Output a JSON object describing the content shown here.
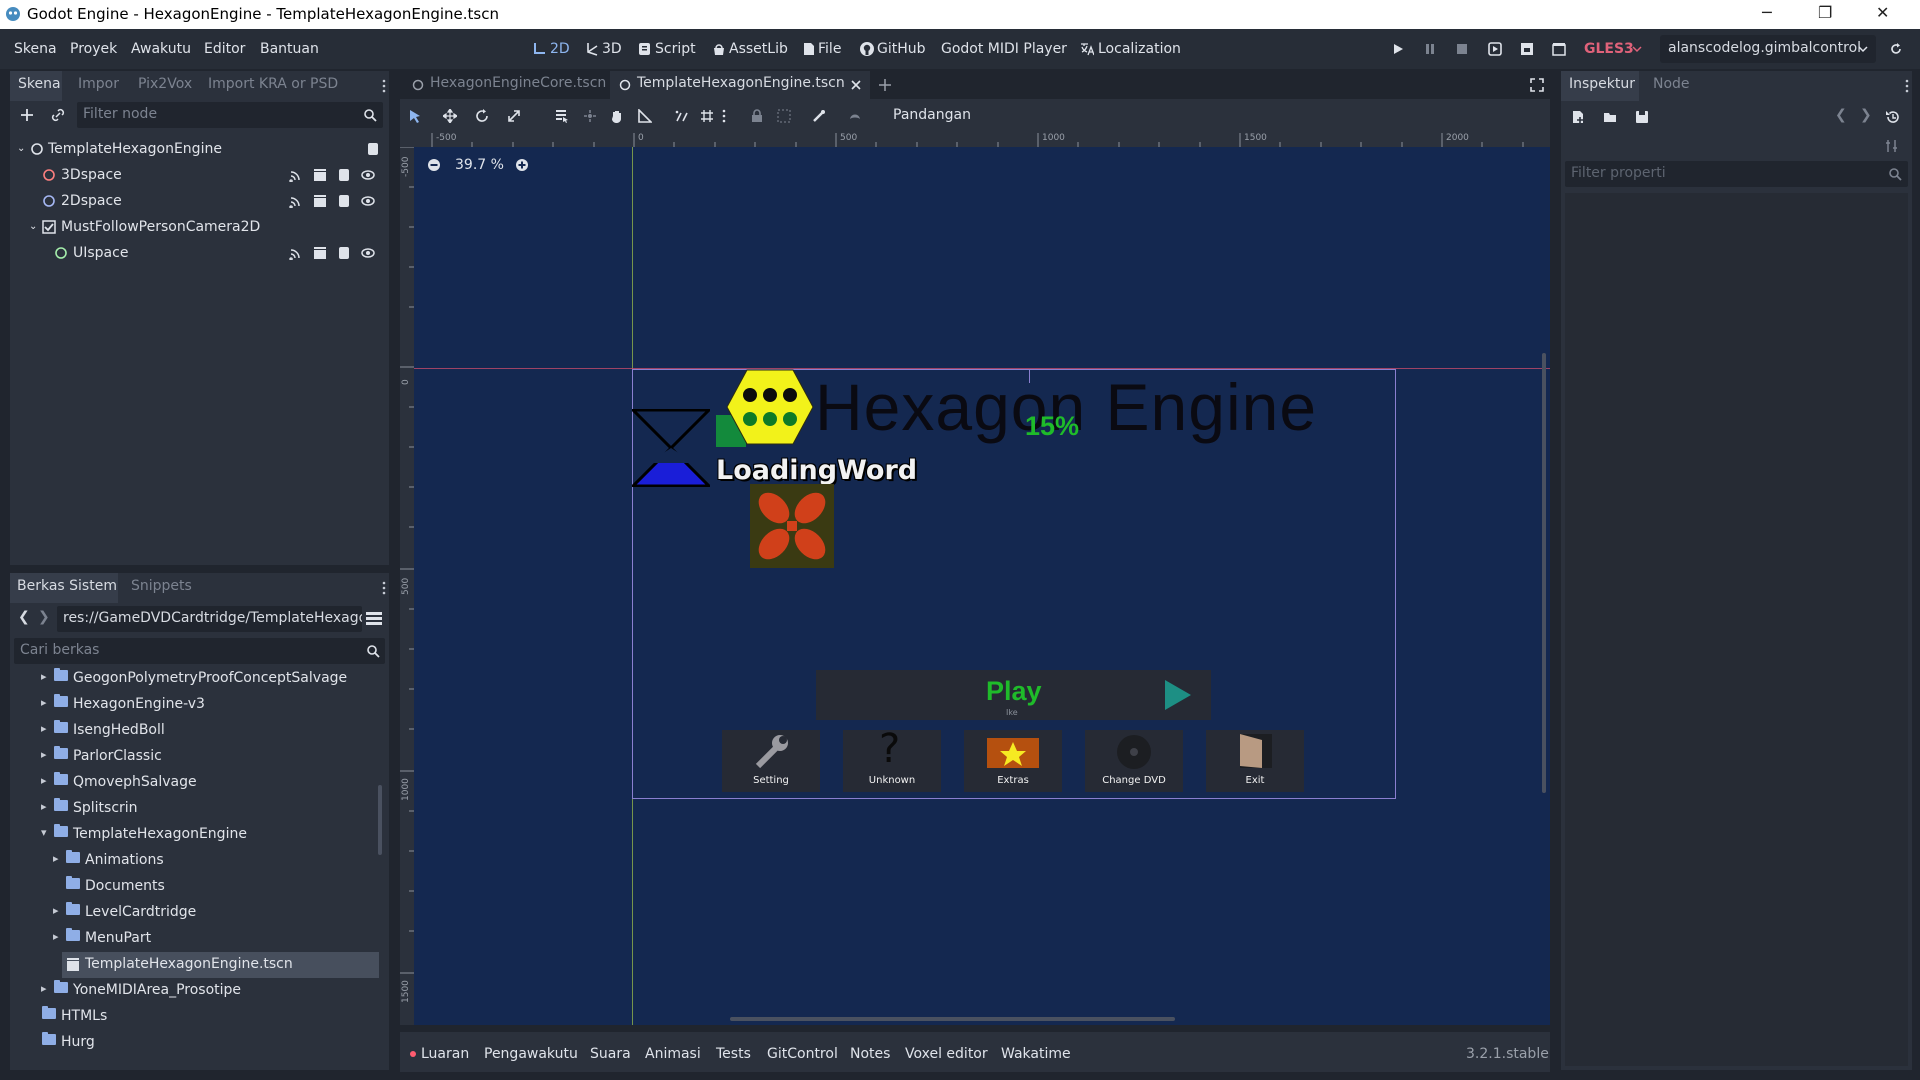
{
  "window": {
    "title": "Godot Engine - HexagonEngine - TemplateHexagonEngine.tscn",
    "minimize_glyph": "─",
    "restore_glyph": "❐",
    "close_glyph": "✕"
  },
  "menus": [
    "Skena",
    "Proyek",
    "Awakutu",
    "Editor",
    "Bantuan"
  ],
  "workspaces": [
    "2D",
    "3D",
    "Script",
    "AssetLib",
    "File",
    "GitHub",
    "Godot MIDI Player",
    "Localization"
  ],
  "run_bar": {
    "renderer": "GLES3",
    "remote": "alanscodelog.gimbalcontrol"
  },
  "scene_dock": {
    "tabs": [
      "Skena",
      "Impor",
      "Pix2Vox",
      "Import KRA or PSD"
    ],
    "filter_placeholder": "Filter node",
    "nodes": [
      {
        "name": "TemplateHexagonEngine",
        "type": "root"
      },
      {
        "name": "3Dspace",
        "type": "spatial"
      },
      {
        "name": "2Dspace",
        "type": "spatial"
      },
      {
        "name": "MustFollowPersonCamera2D",
        "type": "camera2d"
      },
      {
        "name": "UIspace",
        "type": "control"
      }
    ]
  },
  "filesystem_dock": {
    "tabs": [
      "Berkas Sistem",
      "Snippets"
    ],
    "path": "res://GameDVDCardtridge/TemplateHexago",
    "search_placeholder": "Cari berkas",
    "items": [
      {
        "name": "GeogonPolymetryProofConceptSalvage",
        "level": 2
      },
      {
        "name": "HexagonEngine-v3",
        "level": 2
      },
      {
        "name": "IsengHedBoll",
        "level": 2
      },
      {
        "name": "ParlorClassic",
        "level": 2
      },
      {
        "name": "QmovephSalvage",
        "level": 2
      },
      {
        "name": "Splitscrin",
        "level": 2
      },
      {
        "name": "TemplateHexagonEngine",
        "level": 2
      },
      {
        "name": "Animations",
        "level": 3
      },
      {
        "name": "Documents",
        "level": 3
      },
      {
        "name": "LevelCardtridge",
        "level": 3
      },
      {
        "name": "MenuPart",
        "level": 3
      },
      {
        "name": "TemplateHexagonEngine.tscn",
        "level": 3
      },
      {
        "name": "YoneMIDIArea_Prosotipe",
        "level": 2
      },
      {
        "name": "HTMLs",
        "level": 1
      },
      {
        "name": "Hurg",
        "level": 1
      }
    ]
  },
  "editor_tabs": [
    "HexagonEngineCore.tscn",
    "TemplateHexagonEngine.tscn"
  ],
  "toolbar": {
    "view_menu": "Pandangan"
  },
  "viewport": {
    "zoom": "39.7 %",
    "ruler_h": [
      "-500",
      "0",
      "500",
      "1000",
      "1500",
      "2000"
    ],
    "ruler_v": [
      "-500",
      "0",
      "500",
      "1000",
      "1500"
    ],
    "scene": {
      "title": "Hexagon Engine",
      "percent": "15%",
      "loading_word": "LoadingWord",
      "play_label": "Play",
      "play_sub": "Ike",
      "menu_buttons": [
        "Setting",
        "Unknown",
        "Extras",
        "Change DVD",
        "Exit"
      ]
    }
  },
  "inspector": {
    "tabs": [
      "Inspektur",
      "Node"
    ],
    "filter_placeholder": "Filter properti"
  },
  "bottom_panel": {
    "tabs": [
      "Luaran",
      "Pengawakutu",
      "Suara",
      "Animasi",
      "Tests",
      "GitControl",
      "Notes",
      "Voxel editor",
      "Wakatime"
    ],
    "version": "3.2.1.stable"
  },
  "colors": {
    "accent": "#8eb6f0",
    "viewport_bg": "#142850",
    "error_dot": "#ff5c70",
    "gles_red": "#e0627a",
    "play_green": "#1fbb2a",
    "play_arrow": "#1d8f84"
  }
}
